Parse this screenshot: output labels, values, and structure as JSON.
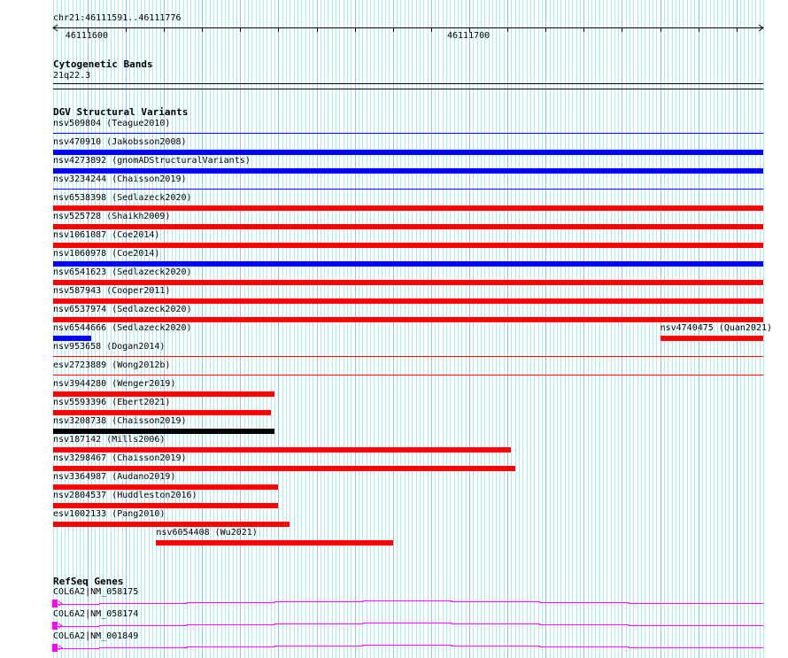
{
  "ruler": {
    "location": "chr21:46111591..46111776",
    "start": 46111591,
    "end": 46111776,
    "labels": [
      {
        "pos": 46111600,
        "text": "46111600"
      },
      {
        "pos": 46111700,
        "text": "46111700"
      }
    ]
  },
  "cyto": {
    "title": "Cytogenetic Bands",
    "band": "21q22.3"
  },
  "dgv": {
    "title": "DGV Structural Variants",
    "rows": [
      [
        {
          "label": "nsv509804 (Teague2010)",
          "start": 46111500,
          "end": 46111900,
          "color": "#0000ff",
          "style": "thin"
        }
      ],
      [
        {
          "label": "nsv470910 (Jakobsson2008)",
          "start": 46111500,
          "end": 46111900,
          "color": "#0000ff",
          "style": "thick"
        }
      ],
      [
        {
          "label": "nsv4273892 (gnomADStructuralVariants)",
          "start": 46111500,
          "end": 46111900,
          "color": "#0000ff",
          "style": "thick"
        }
      ],
      [
        {
          "label": "nsv3234244 (Chaisson2019)",
          "start": 46111500,
          "end": 46111900,
          "color": "#0000ff",
          "style": "thin"
        }
      ],
      [
        {
          "label": "nsv6538398 (Sedlazeck2020)",
          "start": 46111500,
          "end": 46111900,
          "color": "#ff0000",
          "style": "thick"
        }
      ],
      [
        {
          "label": "nsv525728 (Shaikh2009)",
          "start": 46111500,
          "end": 46111900,
          "color": "#ff0000",
          "style": "thick"
        }
      ],
      [
        {
          "label": "nsv1061087 (Coe2014)",
          "start": 46111500,
          "end": 46111900,
          "color": "#ff0000",
          "style": "thick"
        }
      ],
      [
        {
          "label": "nsv1060978 (Coe2014)",
          "start": 46111500,
          "end": 46111900,
          "color": "#0000ff",
          "style": "thick"
        }
      ],
      [
        {
          "label": "nsv6541623 (Sedlazeck2020)",
          "start": 46111500,
          "end": 46111900,
          "color": "#ff0000",
          "style": "thick"
        }
      ],
      [
        {
          "label": "nsv587943 (Cooper2011)",
          "start": 46111500,
          "end": 46111900,
          "color": "#ff0000",
          "style": "thick"
        }
      ],
      [
        {
          "label": "nsv6537974 (Sedlazeck2020)",
          "start": 46111500,
          "end": 46111900,
          "color": "#ff0000",
          "style": "thick"
        }
      ],
      [
        {
          "label": "nsv6544666 (Sedlazeck2020)",
          "start": 46111500,
          "end": 46111601,
          "color": "#0000ff",
          "style": "thick"
        },
        {
          "label": "nsv4740475 (Quan2021)",
          "start": 46111750,
          "end": 46111900,
          "color": "#ff0000",
          "style": "thick"
        }
      ],
      [
        {
          "label": "nsv953658 (Dogan2014)",
          "start": 46111500,
          "end": 46111900,
          "color": "#ff0000",
          "style": "thin"
        }
      ],
      [
        {
          "label": "esv2723889 (Wong2012b)",
          "start": 46111500,
          "end": 46111900,
          "color": "#ff0000",
          "style": "thin"
        }
      ],
      [
        {
          "label": "nsv3944280 (Wenger2019)",
          "start": 46111500,
          "end": 46111649,
          "color": "#ff0000",
          "style": "thick"
        }
      ],
      [
        {
          "label": "nsv5593396 (Ebert2021)",
          "start": 46111500,
          "end": 46111648,
          "color": "#ff0000",
          "style": "thick"
        }
      ],
      [
        {
          "label": "nsv3208738 (Chaisson2019)",
          "start": 46111500,
          "end": 46111649,
          "color": "#000000",
          "style": "thick"
        }
      ],
      [
        {
          "label": "nsv187142 (Mills2006)",
          "start": 46111500,
          "end": 46111711,
          "color": "#ff0000",
          "style": "thick"
        }
      ],
      [
        {
          "label": "nsv3298467 (Chaisson2019)",
          "start": 46111500,
          "end": 46111712,
          "color": "#ff0000",
          "style": "thick"
        }
      ],
      [
        {
          "label": "nsv3364987 (Audano2019)",
          "start": 46111500,
          "end": 46111650,
          "color": "#ff0000",
          "style": "thick"
        }
      ],
      [
        {
          "label": "nsv2804537 (Huddleston2016)",
          "start": 46111500,
          "end": 46111650,
          "color": "#ff0000",
          "style": "thick"
        }
      ],
      [
        {
          "label": "esv1002133 (Pang2010)",
          "start": 46111500,
          "end": 46111653,
          "color": "#ff0000",
          "style": "thick"
        }
      ],
      [
        {
          "label": "nsv6054408 (Wu2021)",
          "start": 46111618,
          "end": 46111680,
          "color": "#ff0000",
          "style": "thick"
        }
      ]
    ]
  },
  "refseq": {
    "title": "RefSeq Genes",
    "color": "#ff00ff",
    "genes": [
      "COL6A2|NM_058175",
      "COL6A2|NM_058174",
      "COL6A2|NM_001849"
    ]
  },
  "colors": {
    "grid_minor": "#a8ecf0",
    "grid_major": "#8cc4ec"
  }
}
